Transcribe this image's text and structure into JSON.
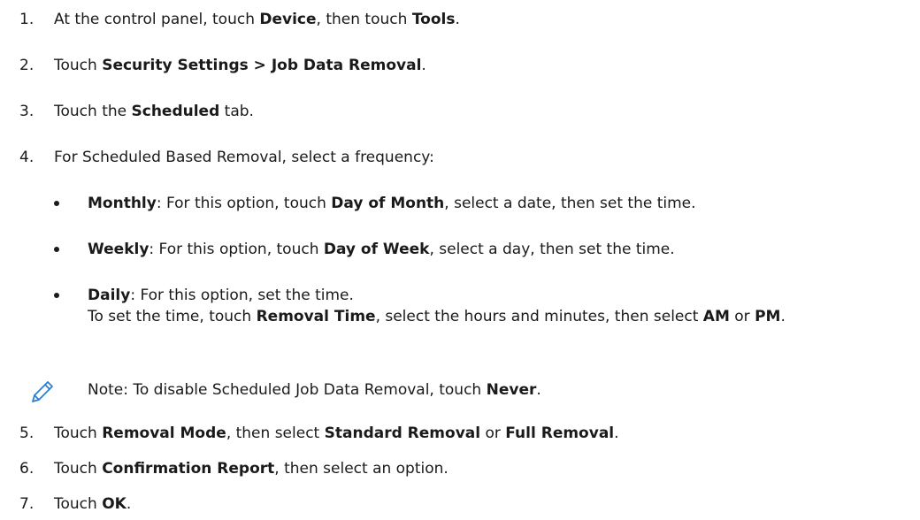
{
  "steps": [
    {
      "num": "1.",
      "segments": [
        "At the control panel, touch ",
        "Device",
        ", then touch ",
        "Tools",
        "."
      ]
    },
    {
      "num": "2.",
      "segments": [
        "Touch ",
        "Security Settings > Job Data Removal",
        "."
      ]
    },
    {
      "num": "3.",
      "segments": [
        "Touch the ",
        "Scheduled",
        " tab."
      ]
    },
    {
      "num": "4.",
      "segments": [
        "For Scheduled Based Removal, select a frequency:"
      ]
    },
    {
      "num": "5.",
      "segments": [
        "Touch ",
        "Removal Mode",
        ", then select ",
        "Standard Removal",
        " or ",
        "Full Removal",
        "."
      ]
    },
    {
      "num": "6.",
      "segments": [
        "Touch ",
        "Confirmation Report",
        ", then select an option."
      ]
    },
    {
      "num": "7.",
      "segments": [
        "Touch ",
        "OK",
        "."
      ]
    }
  ],
  "frequency_options": [
    {
      "segments": [
        "Monthly",
        ": For this option, touch ",
        "Day of Month",
        ", select a date, then set the time."
      ]
    },
    {
      "segments": [
        "Weekly",
        ": For this option, touch ",
        "Day of Week",
        ", select a day, then set the time."
      ]
    },
    {
      "segments": [
        "Daily",
        ": For this option, set the time."
      ]
    }
  ],
  "time_instruction": {
    "segments": [
      "To set the time, touch ",
      "Removal Time",
      ", select the hours and minutes, then select ",
      "AM",
      " or ",
      "PM",
      "."
    ]
  },
  "note": {
    "icon": "pencil-icon",
    "segments": [
      "Note: To disable Scheduled Job Data Removal, touch ",
      "Never",
      "."
    ]
  },
  "colors": {
    "text": "#1a1a1a",
    "note_icon": "#2f7fd0"
  }
}
